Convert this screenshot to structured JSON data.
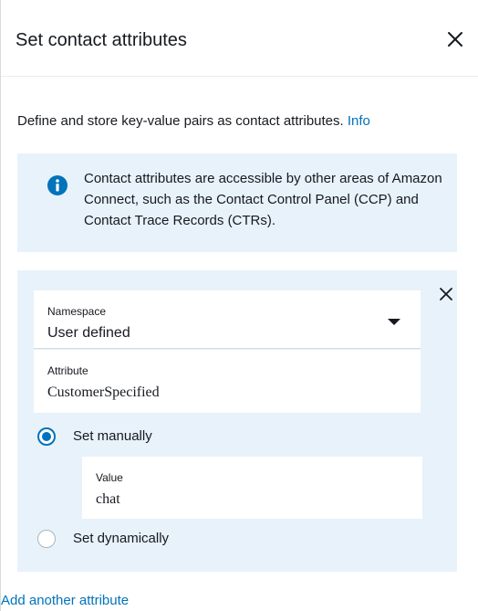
{
  "panel": {
    "title": "Set contact attributes",
    "description": "Define and store key-value pairs as contact attributes.",
    "info_link": "Info",
    "close_icon": "close-icon"
  },
  "info_box": {
    "icon": "info-icon",
    "text": "Contact attributes are accessible by other areas of Amazon Connect, such as the Contact Control Panel (CCP) and Contact Trace Records (CTRs).",
    "accent_color": "#0073bb",
    "background_color": "#e8f2fb"
  },
  "attribute": {
    "namespace": {
      "label": "Namespace",
      "value": "User defined"
    },
    "attribute": {
      "label": "Attribute",
      "value": "CustomerSpecified"
    },
    "options": [
      {
        "label": "Set manually",
        "selected": true
      },
      {
        "label": "Set dynamically",
        "selected": false
      }
    ],
    "value": {
      "label": "Value",
      "value": "chat"
    }
  },
  "actions": {
    "add_another": "Add another attribute"
  },
  "colors": {
    "link": "#0073bb",
    "text": "#16191f"
  }
}
